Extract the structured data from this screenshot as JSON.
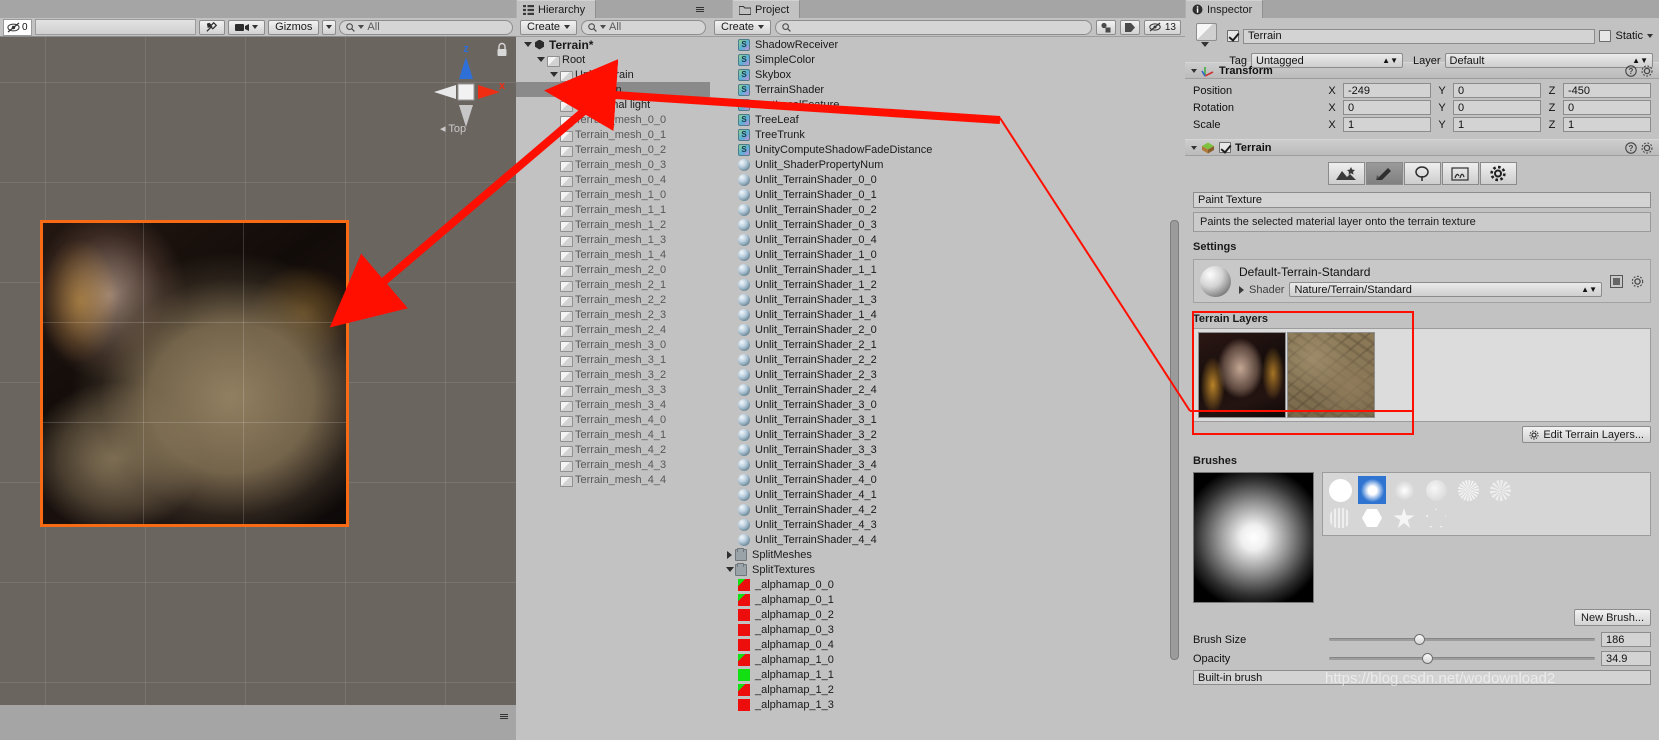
{
  "scene": {
    "tab_label": "",
    "visibility_count": "0",
    "search_placeholder": "All",
    "gizmos_label": "Gizmos",
    "view_label": "Top",
    "axis_z": "z",
    "axis_x": "x"
  },
  "hierarchy": {
    "tab_label": "Hierarchy",
    "create_label": "Create",
    "search_placeholder": "All",
    "items": [
      {
        "label": "Terrain*",
        "depth": 0,
        "icon": "unity-icon",
        "expanded": true,
        "selected": false,
        "dim": false
      },
      {
        "label": "Root",
        "depth": 1,
        "icon": "cube-icon",
        "expanded": true,
        "selected": false,
        "dim": false
      },
      {
        "label": "UnityTerrain",
        "depth": 2,
        "icon": "cube-icon",
        "expanded": true,
        "selected": false,
        "dim": false
      },
      {
        "label": "Terrain",
        "depth": 3,
        "icon": "cube-icon",
        "expanded": false,
        "selected": true,
        "dim": false
      },
      {
        "label": "Directional light",
        "depth": 2,
        "icon": "cube-icon",
        "expanded": false,
        "selected": false,
        "dim": false
      },
      {
        "label": "Terrain_mesh_0_0",
        "depth": 2,
        "icon": "cube-icon",
        "expanded": false,
        "selected": false,
        "dim": true
      },
      {
        "label": "Terrain_mesh_0_1",
        "depth": 2,
        "icon": "cube-icon",
        "expanded": false,
        "selected": false,
        "dim": true
      },
      {
        "label": "Terrain_mesh_0_2",
        "depth": 2,
        "icon": "cube-icon",
        "expanded": false,
        "selected": false,
        "dim": true
      },
      {
        "label": "Terrain_mesh_0_3",
        "depth": 2,
        "icon": "cube-icon",
        "expanded": false,
        "selected": false,
        "dim": true
      },
      {
        "label": "Terrain_mesh_0_4",
        "depth": 2,
        "icon": "cube-icon",
        "expanded": false,
        "selected": false,
        "dim": true
      },
      {
        "label": "Terrain_mesh_1_0",
        "depth": 2,
        "icon": "cube-icon",
        "expanded": false,
        "selected": false,
        "dim": true
      },
      {
        "label": "Terrain_mesh_1_1",
        "depth": 2,
        "icon": "cube-icon",
        "expanded": false,
        "selected": false,
        "dim": true
      },
      {
        "label": "Terrain_mesh_1_2",
        "depth": 2,
        "icon": "cube-icon",
        "expanded": false,
        "selected": false,
        "dim": true
      },
      {
        "label": "Terrain_mesh_1_3",
        "depth": 2,
        "icon": "cube-icon",
        "expanded": false,
        "selected": false,
        "dim": true
      },
      {
        "label": "Terrain_mesh_1_4",
        "depth": 2,
        "icon": "cube-icon",
        "expanded": false,
        "selected": false,
        "dim": true
      },
      {
        "label": "Terrain_mesh_2_0",
        "depth": 2,
        "icon": "cube-icon",
        "expanded": false,
        "selected": false,
        "dim": true
      },
      {
        "label": "Terrain_mesh_2_1",
        "depth": 2,
        "icon": "cube-icon",
        "expanded": false,
        "selected": false,
        "dim": true
      },
      {
        "label": "Terrain_mesh_2_2",
        "depth": 2,
        "icon": "cube-icon",
        "expanded": false,
        "selected": false,
        "dim": true
      },
      {
        "label": "Terrain_mesh_2_3",
        "depth": 2,
        "icon": "cube-icon",
        "expanded": false,
        "selected": false,
        "dim": true
      },
      {
        "label": "Terrain_mesh_2_4",
        "depth": 2,
        "icon": "cube-icon",
        "expanded": false,
        "selected": false,
        "dim": true
      },
      {
        "label": "Terrain_mesh_3_0",
        "depth": 2,
        "icon": "cube-icon",
        "expanded": false,
        "selected": false,
        "dim": true
      },
      {
        "label": "Terrain_mesh_3_1",
        "depth": 2,
        "icon": "cube-icon",
        "expanded": false,
        "selected": false,
        "dim": true
      },
      {
        "label": "Terrain_mesh_3_2",
        "depth": 2,
        "icon": "cube-icon",
        "expanded": false,
        "selected": false,
        "dim": true
      },
      {
        "label": "Terrain_mesh_3_3",
        "depth": 2,
        "icon": "cube-icon",
        "expanded": false,
        "selected": false,
        "dim": true
      },
      {
        "label": "Terrain_mesh_3_4",
        "depth": 2,
        "icon": "cube-icon",
        "expanded": false,
        "selected": false,
        "dim": true
      },
      {
        "label": "Terrain_mesh_4_0",
        "depth": 2,
        "icon": "cube-icon",
        "expanded": false,
        "selected": false,
        "dim": true
      },
      {
        "label": "Terrain_mesh_4_1",
        "depth": 2,
        "icon": "cube-icon",
        "expanded": false,
        "selected": false,
        "dim": true
      },
      {
        "label": "Terrain_mesh_4_2",
        "depth": 2,
        "icon": "cube-icon",
        "expanded": false,
        "selected": false,
        "dim": true
      },
      {
        "label": "Terrain_mesh_4_3",
        "depth": 2,
        "icon": "cube-icon",
        "expanded": false,
        "selected": false,
        "dim": true
      },
      {
        "label": "Terrain_mesh_4_4",
        "depth": 2,
        "icon": "cube-icon",
        "expanded": false,
        "selected": false,
        "dim": true
      }
    ]
  },
  "project": {
    "tab_label": "Project",
    "create_label": "Create",
    "search_placeholder": "",
    "badge_count": "13",
    "items": [
      {
        "label": "ShadowReceiver",
        "icon": "shader-icon",
        "depth": 1
      },
      {
        "label": "SimpleColor",
        "icon": "shader-icon",
        "depth": 1
      },
      {
        "label": "Skybox",
        "icon": "shader-icon",
        "depth": 1
      },
      {
        "label": "TerrainShader",
        "icon": "shader-icon",
        "depth": 1
      },
      {
        "label": "TestLocalFeature",
        "icon": "shader-icon",
        "depth": 1
      },
      {
        "label": "TreeLeaf",
        "icon": "shader-icon",
        "depth": 1
      },
      {
        "label": "TreeTrunk",
        "icon": "shader-icon",
        "depth": 1
      },
      {
        "label": "UnityComputeShadowFadeDistance",
        "icon": "shader-icon",
        "depth": 1
      },
      {
        "label": "Unlit_ShaderPropertyNum",
        "icon": "material-icon",
        "depth": 1
      },
      {
        "label": "Unlit_TerrainShader_0_0",
        "icon": "material-icon",
        "depth": 1
      },
      {
        "label": "Unlit_TerrainShader_0_1",
        "icon": "material-icon",
        "depth": 1
      },
      {
        "label": "Unlit_TerrainShader_0_2",
        "icon": "material-icon",
        "depth": 1
      },
      {
        "label": "Unlit_TerrainShader_0_3",
        "icon": "material-icon",
        "depth": 1
      },
      {
        "label": "Unlit_TerrainShader_0_4",
        "icon": "material-icon",
        "depth": 1
      },
      {
        "label": "Unlit_TerrainShader_1_0",
        "icon": "material-icon",
        "depth": 1
      },
      {
        "label": "Unlit_TerrainShader_1_1",
        "icon": "material-icon",
        "depth": 1
      },
      {
        "label": "Unlit_TerrainShader_1_2",
        "icon": "material-icon",
        "depth": 1
      },
      {
        "label": "Unlit_TerrainShader_1_3",
        "icon": "material-icon",
        "depth": 1
      },
      {
        "label": "Unlit_TerrainShader_1_4",
        "icon": "material-icon",
        "depth": 1
      },
      {
        "label": "Unlit_TerrainShader_2_0",
        "icon": "material-icon",
        "depth": 1
      },
      {
        "label": "Unlit_TerrainShader_2_1",
        "icon": "material-icon",
        "depth": 1
      },
      {
        "label": "Unlit_TerrainShader_2_2",
        "icon": "material-icon",
        "depth": 1
      },
      {
        "label": "Unlit_TerrainShader_2_3",
        "icon": "material-icon",
        "depth": 1
      },
      {
        "label": "Unlit_TerrainShader_2_4",
        "icon": "material-icon",
        "depth": 1
      },
      {
        "label": "Unlit_TerrainShader_3_0",
        "icon": "material-icon",
        "depth": 1
      },
      {
        "label": "Unlit_TerrainShader_3_1",
        "icon": "material-icon",
        "depth": 1
      },
      {
        "label": "Unlit_TerrainShader_3_2",
        "icon": "material-icon",
        "depth": 1
      },
      {
        "label": "Unlit_TerrainShader_3_3",
        "icon": "material-icon",
        "depth": 1
      },
      {
        "label": "Unlit_TerrainShader_3_4",
        "icon": "material-icon",
        "depth": 1
      },
      {
        "label": "Unlit_TerrainShader_4_0",
        "icon": "material-icon",
        "depth": 1
      },
      {
        "label": "Unlit_TerrainShader_4_1",
        "icon": "material-icon",
        "depth": 1
      },
      {
        "label": "Unlit_TerrainShader_4_2",
        "icon": "material-icon",
        "depth": 1
      },
      {
        "label": "Unlit_TerrainShader_4_3",
        "icon": "material-icon",
        "depth": 1
      },
      {
        "label": "Unlit_TerrainShader_4_4",
        "icon": "material-icon",
        "depth": 1
      },
      {
        "label": "SplitMeshes",
        "icon": "folder-icon",
        "depth": 0,
        "foldout": "collapsed"
      },
      {
        "label": "SplitTextures",
        "icon": "folder-icon",
        "depth": 0,
        "foldout": "expanded"
      },
      {
        "label": "_alphamap_0_0",
        "icon": "alphamap-icon",
        "depth": 1,
        "swatch": "red-green"
      },
      {
        "label": "_alphamap_0_1",
        "icon": "alphamap-icon",
        "depth": 1,
        "swatch": "red-green"
      },
      {
        "label": "_alphamap_0_2",
        "icon": "alphamap-icon",
        "depth": 1,
        "swatch": "red"
      },
      {
        "label": "_alphamap_0_3",
        "icon": "alphamap-icon",
        "depth": 1,
        "swatch": "red"
      },
      {
        "label": "_alphamap_0_4",
        "icon": "alphamap-icon",
        "depth": 1,
        "swatch": "red"
      },
      {
        "label": "_alphamap_1_0",
        "icon": "alphamap-icon",
        "depth": 1,
        "swatch": "red-green"
      },
      {
        "label": "_alphamap_1_1",
        "icon": "alphamap-icon",
        "depth": 1,
        "swatch": "green"
      },
      {
        "label": "_alphamap_1_2",
        "icon": "alphamap-icon",
        "depth": 1,
        "swatch": "red-green"
      },
      {
        "label": "_alphamap_1_3",
        "icon": "alphamap-icon",
        "depth": 1,
        "swatch": "red"
      }
    ]
  },
  "inspector": {
    "tab_label": "Inspector",
    "static_label": "Static",
    "object_name": "Terrain",
    "tag_label": "Tag",
    "tag_value": "Untagged",
    "layer_label": "Layer",
    "layer_value": "Default",
    "transform": {
      "title": "Transform",
      "rows": [
        {
          "label": "Position",
          "x": "-249",
          "y": "0",
          "z": "-450"
        },
        {
          "label": "Rotation",
          "x": "0",
          "y": "0",
          "z": "0"
        },
        {
          "label": "Scale",
          "x": "1",
          "y": "1",
          "z": "1"
        }
      ],
      "axis_labels": [
        "X",
        "Y",
        "Z"
      ]
    },
    "terrain": {
      "title": "Terrain",
      "tools": [
        {
          "name": "raise-lower-terrain-tool",
          "glyph": "mountain",
          "active": false
        },
        {
          "name": "paint-texture-tool",
          "glyph": "brush",
          "active": true
        },
        {
          "name": "place-trees-tool",
          "glyph": "tree",
          "active": false
        },
        {
          "name": "paint-details-tool",
          "glyph": "grass",
          "active": false
        },
        {
          "name": "terrain-settings-tool",
          "glyph": "gear",
          "active": false
        }
      ],
      "tool_title": "Paint Texture",
      "tool_help": "Paints the selected material layer onto the terrain texture",
      "settings_label": "Settings",
      "material_name": "Default-Terrain-Standard",
      "shader_label": "Shader",
      "shader_value": "Nature/Terrain/Standard",
      "layers_label": "Terrain Layers",
      "edit_layers_label": "Edit Terrain Layers...",
      "layer_thumbs": [
        "portrait-texture",
        "dirt-texture"
      ],
      "brushes_label": "Brushes",
      "brush_size_label": "Brush Size",
      "brush_size_value": "186",
      "opacity_label": "Opacity",
      "opacity_value": "34.9",
      "builtin_brush_label": "Built-in brush",
      "new_brush_label": "New Brush..."
    }
  },
  "watermark": "https://blog.csdn.net/wodownload2",
  "colors": {
    "accent_orange": "#f96a14",
    "annotation_red": "#ff0f00",
    "panel_bg": "#c2c2c2",
    "scene_bg": "#6b6560",
    "selection": "#8a8a8a",
    "brush_select_blue": "#2f74d0"
  }
}
